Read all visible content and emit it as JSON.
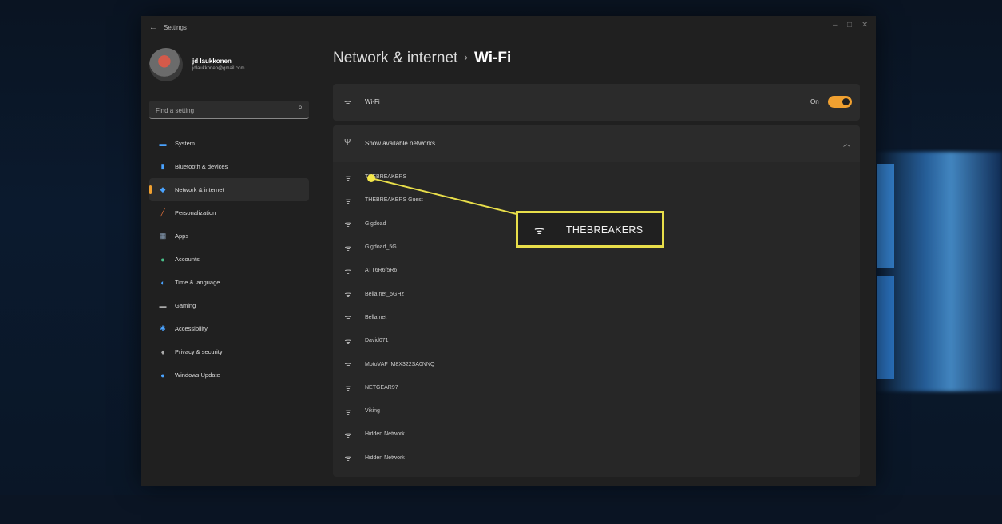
{
  "window": {
    "title": "Settings"
  },
  "user": {
    "name": "jd laukkonen",
    "email": "jdlaukkonen@gmail.com"
  },
  "search": {
    "placeholder": "Find a setting"
  },
  "sidebar": {
    "items": [
      {
        "label": "System",
        "icon": "monitor-icon",
        "color": "#4aa3ff"
      },
      {
        "label": "Bluetooth & devices",
        "icon": "bluetooth-icon",
        "color": "#4aa3ff"
      },
      {
        "label": "Network & internet",
        "icon": "wifi-diamond-icon",
        "color": "#4aa3ff",
        "active": true
      },
      {
        "label": "Personalization",
        "icon": "brush-icon",
        "color": "#e0703a"
      },
      {
        "label": "Apps",
        "icon": "apps-icon",
        "color": "#8aa0b8"
      },
      {
        "label": "Accounts",
        "icon": "person-icon",
        "color": "#4ac08a"
      },
      {
        "label": "Time & language",
        "icon": "globe-icon",
        "color": "#4aa3ff"
      },
      {
        "label": "Gaming",
        "icon": "gamepad-icon",
        "color": "#aaaaaa"
      },
      {
        "label": "Accessibility",
        "icon": "accessibility-icon",
        "color": "#4aa3ff"
      },
      {
        "label": "Privacy & security",
        "icon": "shield-icon",
        "color": "#aaaaaa"
      },
      {
        "label": "Windows Update",
        "icon": "update-icon",
        "color": "#4aa3ff"
      }
    ]
  },
  "header": {
    "crumb": "Network & internet",
    "separator": "›",
    "current": "Wi-Fi"
  },
  "wifi": {
    "label": "Wi-Fi",
    "toggle_text": "On",
    "enabled": true,
    "accent": "#f0a030"
  },
  "networks": {
    "header_label": "Show available networks",
    "items": [
      {
        "name": "THEBREAKERS"
      },
      {
        "name": "THEBREAKERS Guest"
      },
      {
        "name": "Gigdoad"
      },
      {
        "name": "Gigdoad_5G"
      },
      {
        "name": "ATT6R6f5R6"
      },
      {
        "name": "Bella net_5GHz"
      },
      {
        "name": "Bella net"
      },
      {
        "name": "David071"
      },
      {
        "name": "MotoVAF_M8X322SA0NNQ"
      },
      {
        "name": "NETGEAR97"
      },
      {
        "name": "Viking"
      },
      {
        "name": "Hidden Network"
      },
      {
        "name": "Hidden Network"
      }
    ]
  },
  "callout": {
    "text": "THEBREAKERS",
    "color": "#e8de4a"
  }
}
